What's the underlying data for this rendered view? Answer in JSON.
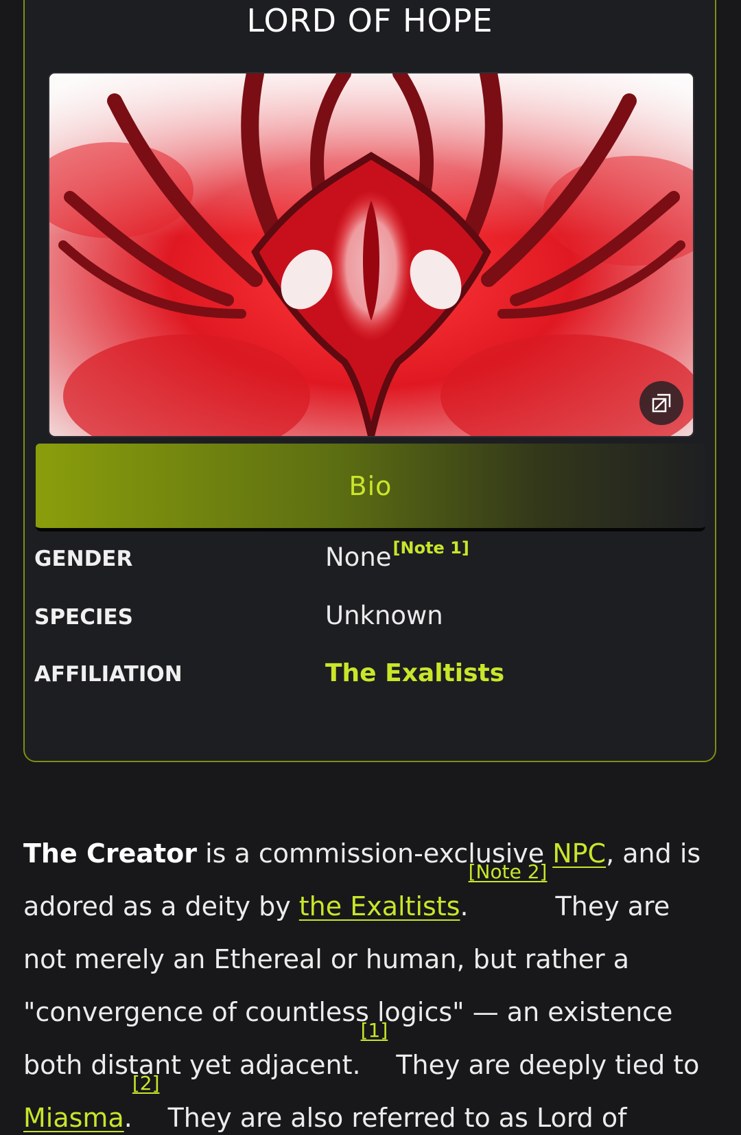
{
  "infobox": {
    "title": "LORD OF HOPE",
    "image_alt": "red eye emblem artwork",
    "bio_tab_label": "Bio",
    "rows": [
      {
        "key": "GENDER",
        "value": "None",
        "note": "[Note 1]"
      },
      {
        "key": "SPECIES",
        "value": "Unknown"
      },
      {
        "key": "AFFILIATION",
        "value": "The Exaltists"
      }
    ]
  },
  "article": {
    "bold_name": "The Creator",
    "t1": " is a commission-exclusive ",
    "link_npc": "NPC",
    "t2": ", and is adored as a deity by ",
    "link_exaltists": "the Exaltists",
    "t3": ".",
    "ref_note2": "[Note 2]",
    "t4": " They are not merely an Ethereal or human, but rather a \"convergence of countless logics\" — an existence both distant yet adjacent.",
    "ref_1": "[1]",
    "t5": " They are deeply tied to ",
    "link_miasma": "Miasma",
    "t6": ".",
    "ref_2": "[2]",
    "t7": " They are also referred to as Lord of"
  },
  "colors": {
    "accent": "#c9e62a",
    "background": "#18181a",
    "infobox_bg": "#1d1e22",
    "border": "#7f8f14"
  },
  "icons": {
    "expand": "expand-image-icon"
  }
}
